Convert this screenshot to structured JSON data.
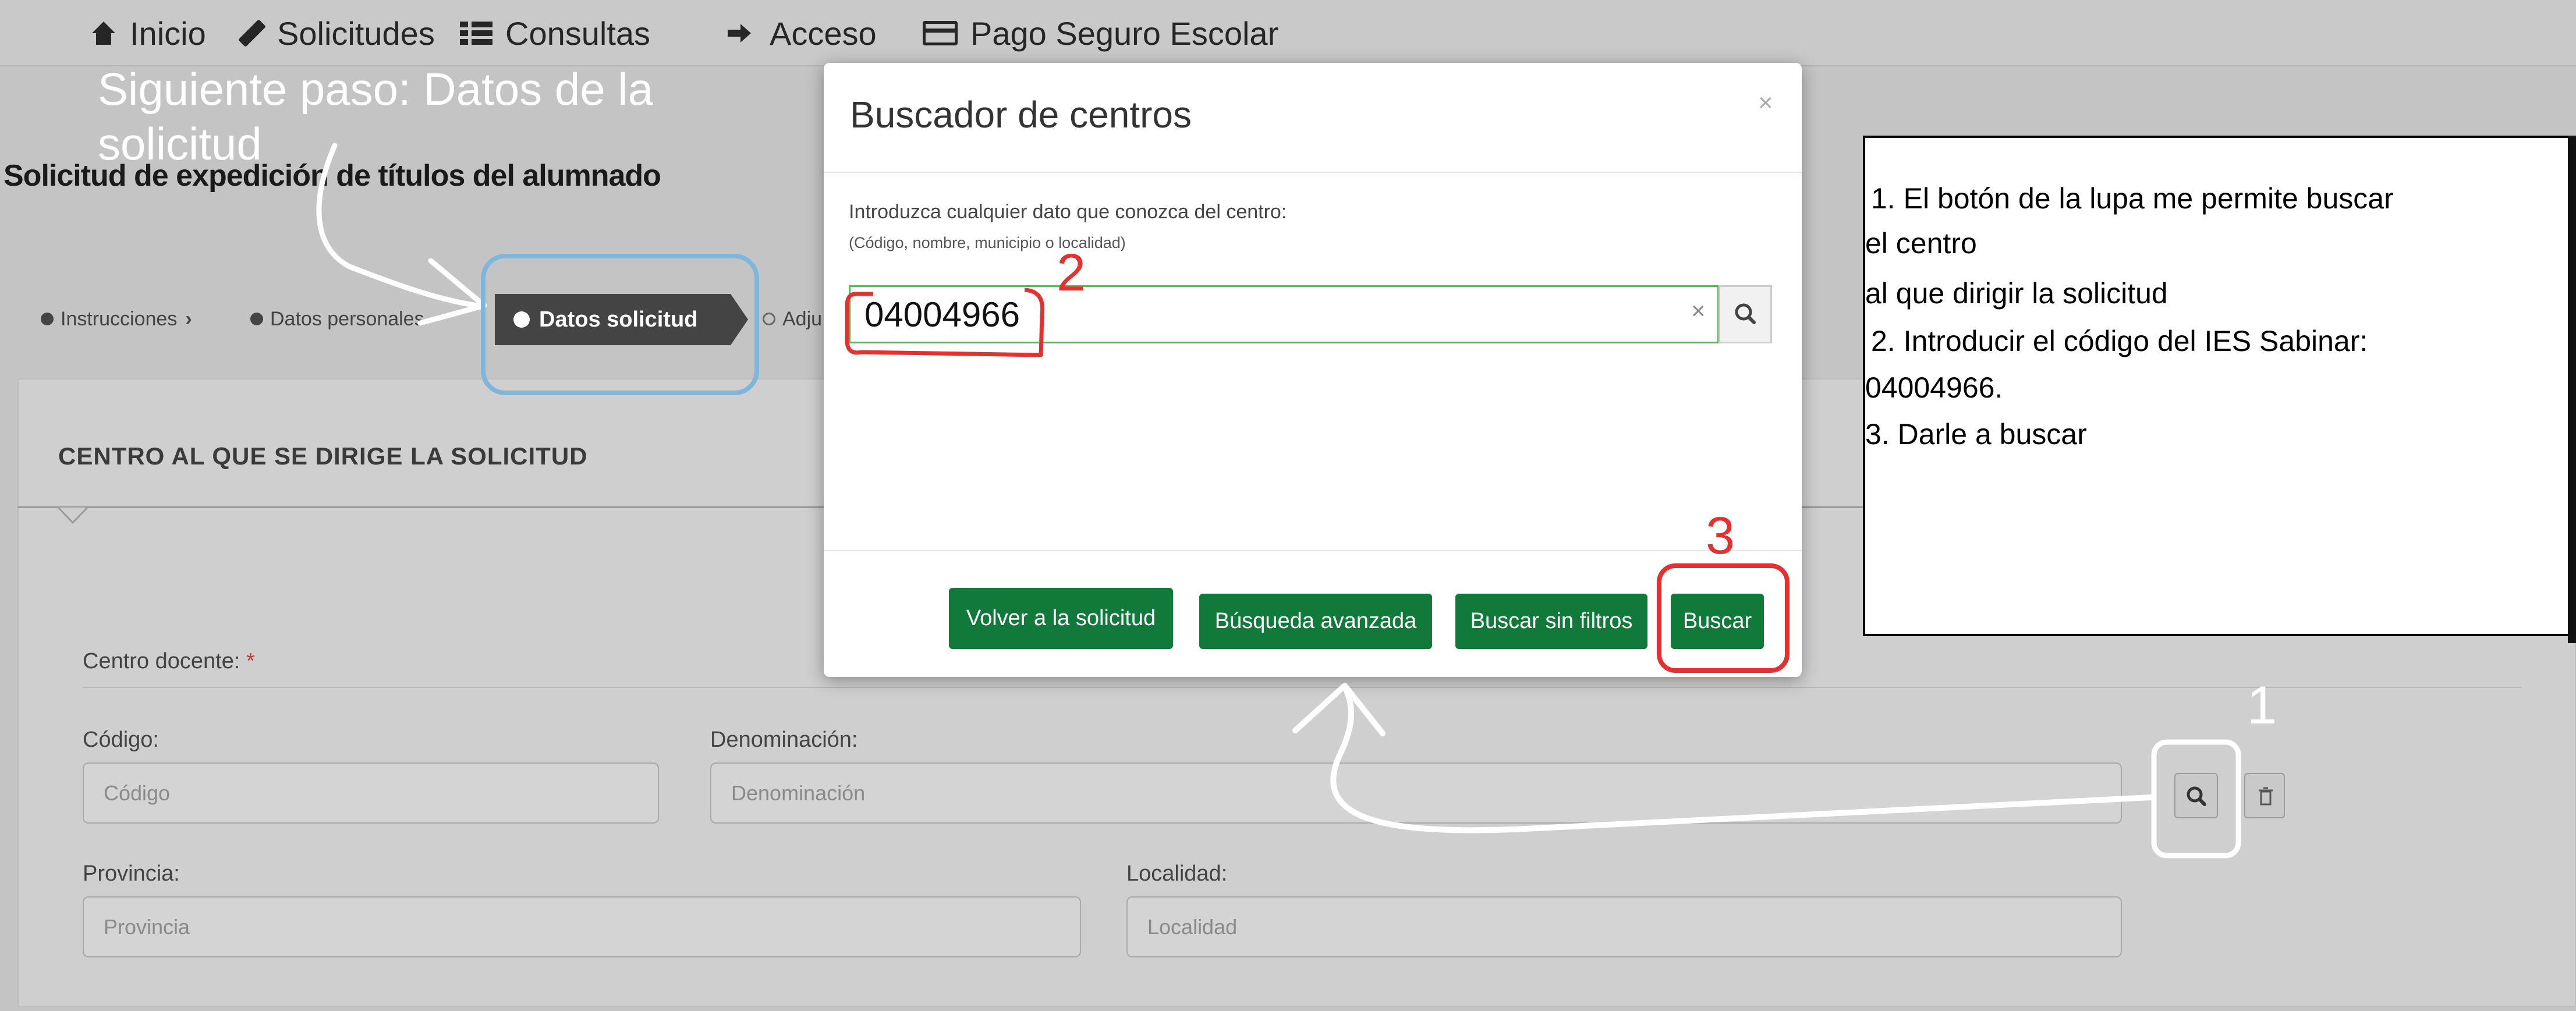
{
  "nav": {
    "items": [
      {
        "label": "Inicio",
        "icon": "home-icon"
      },
      {
        "label": "Solicitudes",
        "icon": "pencil-icon"
      },
      {
        "label": "Consultas",
        "icon": "list-icon"
      },
      {
        "label": "Acceso",
        "icon": "sign-in-icon"
      },
      {
        "label": "Pago Seguro Escolar",
        "icon": "credit-card-icon"
      }
    ]
  },
  "page": {
    "title": "Solicitud de expedición de títulos del alumnado",
    "breadcrumb": {
      "step1": "Instrucciones",
      "step2": "Datos personales",
      "active": "Datos solicitud",
      "next": "Adju"
    },
    "panel_title": "CENTRO AL QUE SE DIRIGE LA SOLICITUD",
    "centro_label": "Centro docente:",
    "required_mark": "*",
    "fields": {
      "codigo": {
        "label": "Código:",
        "placeholder": "Código"
      },
      "denominacion": {
        "label": "Denominación:",
        "placeholder": "Denominación"
      },
      "provincia": {
        "label": "Provincia:",
        "placeholder": "Provincia"
      },
      "localidad": {
        "label": "Localidad:",
        "placeholder": "Localidad"
      }
    }
  },
  "modal": {
    "title": "Buscador de centros",
    "close": "×",
    "help": "Introduzca cualquier dato que conozca del centro:",
    "help_sub": "(Código, nombre, municipio o localidad)",
    "search_value": "04004966",
    "clear": "×",
    "buttons": {
      "back": "Volver a la solicitud",
      "advanced": "Búsqueda avanzada",
      "no_filters": "Buscar sin filtros",
      "search": "Buscar"
    }
  },
  "annotations": {
    "next_step": "Siguiente paso: Datos de la solicitud",
    "num1": "1",
    "num2": "2",
    "num3": "3",
    "box_lines": [
      " 1. El botón de la lupa me permite buscar",
      "el centro",
      "al que dirigir la solicitud",
      " 2. Introducir el código del IES Sabinar:",
      "04004966.",
      "3. Darle a buscar"
    ]
  },
  "colors": {
    "primary_green": "#117a3b",
    "input_focus": "#5cb85c",
    "annotation_red": "#e53030",
    "highlight_blue": "#7fb6dc"
  }
}
